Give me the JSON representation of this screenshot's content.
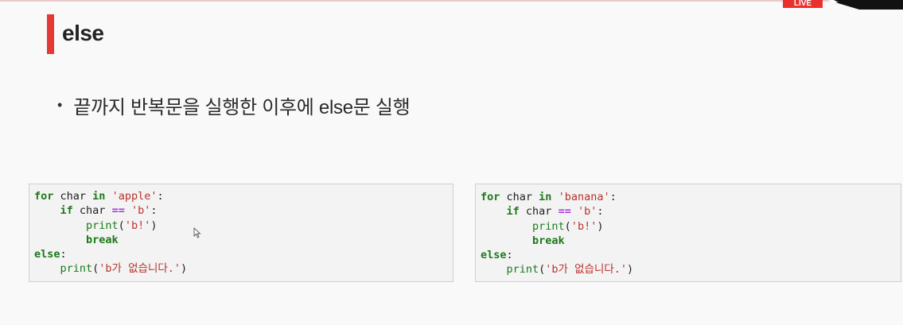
{
  "header": {
    "live_label": "LIVE"
  },
  "slide": {
    "title": "else",
    "bullet": "끝까지 반복문을 실행한 이후에 else문 실행"
  },
  "code_left": {
    "l1": {
      "kw_for": "for",
      "var": " char ",
      "kw_in": "in",
      "sp": " ",
      "str": "'apple'",
      "end": ":"
    },
    "l2": {
      "indent": "    ",
      "kw_if": "if",
      "var": " char ",
      "op": "==",
      "sp": " ",
      "str": "'b'",
      "end": ":"
    },
    "l3": {
      "indent": "        ",
      "fn": "print",
      "open": "(",
      "str": "'b!'",
      "close": ")"
    },
    "l4": {
      "indent": "        ",
      "kw": "break"
    },
    "l5": {
      "kw": "else",
      "end": ":"
    },
    "l6": {
      "indent": "    ",
      "fn": "print",
      "open": "(",
      "str": "'b가 없습니다.'",
      "close": ")"
    }
  },
  "code_right": {
    "l1": {
      "kw_for": "for",
      "var": " char ",
      "kw_in": "in",
      "sp": " ",
      "str": "'banana'",
      "end": ":"
    },
    "l2": {
      "indent": "    ",
      "kw_if": "if",
      "var": " char ",
      "op": "==",
      "sp": " ",
      "str": "'b'",
      "end": ":"
    },
    "l3": {
      "indent": "        ",
      "fn": "print",
      "open": "(",
      "str": "'b!'",
      "close": ")"
    },
    "l4": {
      "indent": "        ",
      "kw": "break"
    },
    "l5": {
      "kw": "else",
      "end": ":"
    },
    "l6": {
      "indent": "    ",
      "fn": "print",
      "open": "(",
      "str": "'b가 없습니다.'",
      "close": ")"
    }
  },
  "colors": {
    "accent": "#e43a36",
    "keyword": "#1b7a1b",
    "string": "#b9332d",
    "operator": "#a82ee0",
    "code_background": "#f3f3f3"
  },
  "icons": {
    "cursor": "mouse-cursor-icon",
    "corner": "corner-arrow-icon"
  }
}
